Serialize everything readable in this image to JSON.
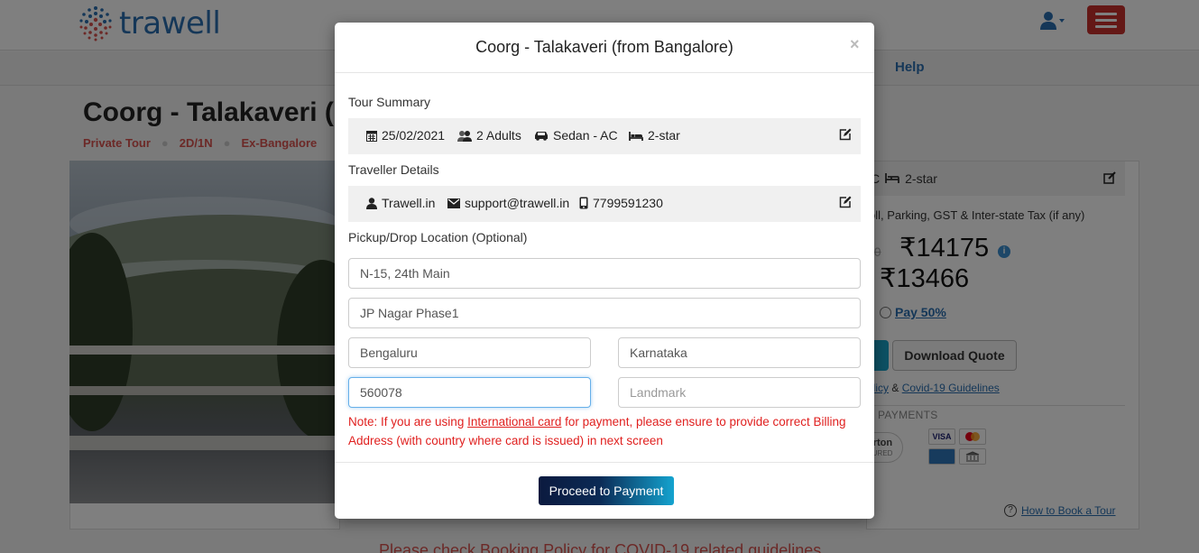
{
  "header": {
    "logo_text": "trawell",
    "nav_help": "Help"
  },
  "page": {
    "title": "Coorg - Talakaveri (",
    "tags": [
      "Private Tour",
      "2D/1N",
      "Ex-Bangalore"
    ]
  },
  "sidebar": {
    "summary_partial": "C",
    "summary_hotel": "2-star",
    "inclusions": "oll, Parking, GST & Inter-state Tax (if any)",
    "price_strike": "00",
    "price_main": "₹14175",
    "price_info_icon": "i",
    "price_discounted": "₹13466",
    "pay_partial_label": "Pay 50%",
    "download_quote": "Download Quote",
    "policy_link": "olicy",
    "policy_amp": "&",
    "covid_link": "Covid-19 Guidelines",
    "payments_label": "E PAYMENTS",
    "norton_text": "orton",
    "norton_sub": "CURED",
    "how_to_book": "How to Book a Tour",
    "covid_banner": "Please check Booking Policy for COVID-19 related guidelines"
  },
  "modal": {
    "title": "Coorg - Talakaveri (from Bangalore)",
    "close": "×",
    "tour_summary_label": "Tour Summary",
    "tour_summary": {
      "date": "25/02/2021",
      "adults": "2 Adults",
      "vehicle": "Sedan - AC",
      "hotel": "2-star"
    },
    "traveller_label": "Traveller Details",
    "traveller": {
      "name": "Trawell.in",
      "email": "support@trawell.in",
      "phone": "7799591230"
    },
    "pickup_label": "Pickup/Drop Location (Optional)",
    "address": {
      "line1": "N-15, 24th Main",
      "line2": "JP Nagar Phase1",
      "city": "Bengaluru",
      "state": "Karnataka",
      "pincode": "560078",
      "landmark_placeholder": "Landmark"
    },
    "note": {
      "prefix": "Note: If you are using ",
      "link": "International card",
      "suffix": " for payment, please ensure to provide correct Billing Address (with country where card is issued) in next screen"
    },
    "proceed_button": "Proceed to Payment"
  },
  "colors": {
    "brand_blue": "#2a6fb0",
    "menu_red": "#c9302c",
    "note_red": "#e0201f",
    "button_dark": "#0b1a3f",
    "button_cyan": "#14a3cf"
  }
}
